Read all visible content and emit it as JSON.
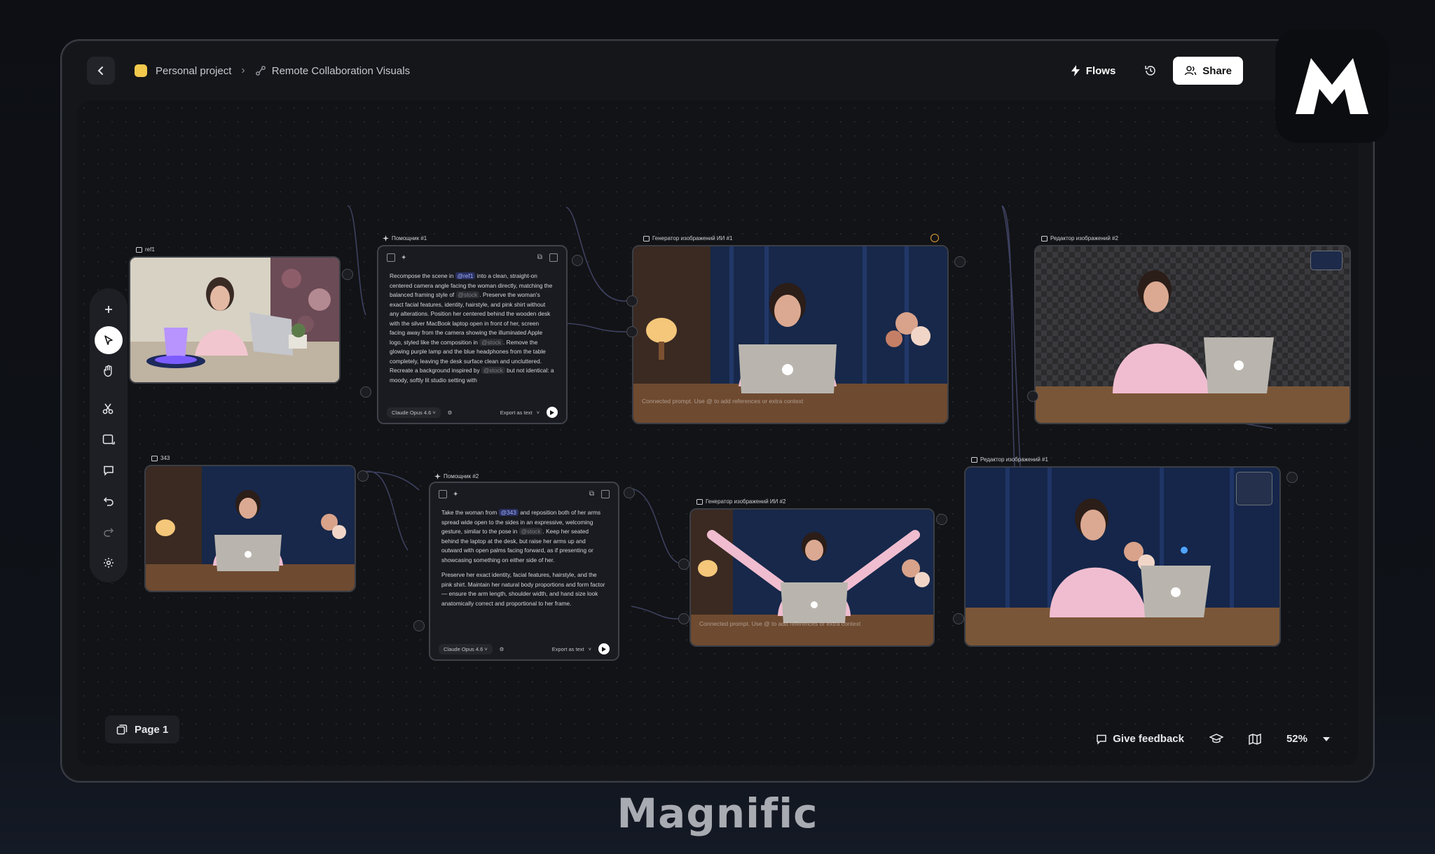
{
  "header": {
    "project_color": "#f2c94c",
    "project_name": "Personal project",
    "page_name": "Remote Collaboration Visuals",
    "flows_label": "Flows",
    "share_label": "Share"
  },
  "toolbar": {
    "tools": [
      "add-icon",
      "pointer-icon",
      "hand-icon",
      "scissors-icon",
      "frame-icon",
      "comment-icon",
      "undo-icon",
      "redo-icon",
      "settings-icon"
    ],
    "active_tool": "pointer-icon"
  },
  "nodes": {
    "ref1": {
      "label": "ref1"
    },
    "img343": {
      "label": "343"
    },
    "assistant1": {
      "label": "Помощник #1",
      "text_parts": [
        "Recompose the scene in ",
        "@ref1",
        " into a clean, straight-on centered camera angle facing the woman directly, matching the balanced framing style of ",
        "@stock",
        ". Preserve the woman's exact facial features, identity, hairstyle, and pink shirt without any alterations. Position her centered behind the wooden desk with the silver MacBook laptop open in front of her, screen facing away from the camera showing the illuminated Apple logo, styled like the composition in ",
        "@stock",
        ". Remove the glowing purple lamp and the blue headphones from the table completely, leaving the desk surface clean and uncluttered. Recreate a background inspired by ",
        "@stock",
        " but not identical: a moody, softly lit studio setting with"
      ],
      "model": "Claude Opus 4.6",
      "export_label": "Export as text"
    },
    "assistant2": {
      "label": "Помощник #2",
      "text_parts": [
        "Take the woman from ",
        "@343",
        " and reposition both of her arms spread wide open to the sides in an expressive, welcoming gesture, similar to the pose in ",
        "@stock",
        ". Keep her seated behind the laptop at the desk, but raise her arms up and outward with open palms facing forward, as if presenting or showcasing something on either side of her."
      ],
      "paragraph2": "Preserve her exact identity, facial features, hairstyle, and the pink shirt. Maintain her natural body proportions and form factor — ensure the arm length, shoulder width, and hand size look anatomically correct and proportional to her frame.",
      "model": "Claude Opus 4.6",
      "export_label": "Export as text"
    },
    "generator1": {
      "label": "Генератор изображений ИИ #1",
      "caption": "Connected prompt. Use @ to add references or extra context"
    },
    "generator2": {
      "label": "Генератор изображений ИИ #2",
      "caption": "Connected prompt. Use @ to add references or extra context"
    },
    "editor2": {
      "label": "Редактор изображений #2"
    },
    "editor1": {
      "label": "Редактор изображений #1"
    }
  },
  "footer": {
    "page_label": "Page 1",
    "feedback_label": "Give feedback",
    "zoom": "52%"
  },
  "brand": {
    "wordmark": "Magnific"
  }
}
